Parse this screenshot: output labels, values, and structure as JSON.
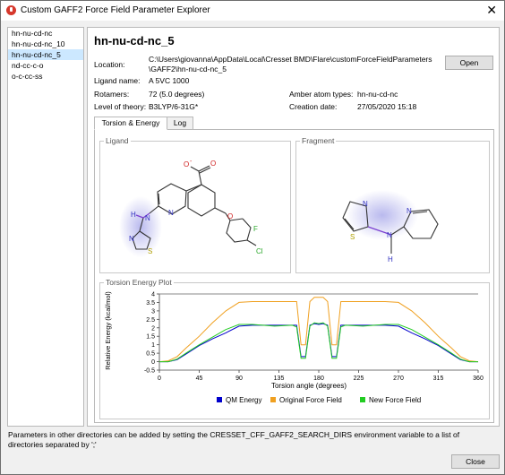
{
  "window": {
    "title": "Custom GAFF2 Force Field Parameter Explorer",
    "close_glyph": "✕"
  },
  "parameter_list": [
    "hn-nu-cd-nc",
    "hn-nu-cd-nc_10",
    "hn-nu-cd-nc_5",
    "nd-cc-c-o",
    "o-c-cc-ss"
  ],
  "selected_index": 2,
  "details": {
    "name": "hn-nu-cd-nc_5",
    "location_label": "Location:",
    "location_line1": "C:\\Users\\giovanna\\AppData\\Local\\Cresset BMD\\Flare\\customForceFieldParameters",
    "location_line2": "\\GAFF2\\hn-nu-cd-nc_5",
    "open_button": "Open",
    "ligand_name_label": "Ligand name:",
    "ligand_name": "A 5VC 1000",
    "rotamers_label": "Rotamers:",
    "rotamers": "72 (5.0 degrees)",
    "amber_label": "Amber atom types:",
    "amber_types": "hn-nu-cd-nc",
    "theory_label": "Level of theory:",
    "theory": "B3LYP/6-31G*",
    "date_label": "Creation date:",
    "date": "27/05/2020 15:18"
  },
  "tabs": [
    "Torsion & Energy",
    "Log"
  ],
  "active_tab": 0,
  "ligand_group_title": "Ligand",
  "fragment_group_title": "Fragment",
  "plot_group_title": "Torsion Energy Plot",
  "molecule_labels": {
    "ligand": {
      "o_minus": "O",
      "charge": "-",
      "o_carbonyl": "O",
      "o_ether": "O",
      "n1": "N",
      "n2": "N",
      "h": "H",
      "s": "S",
      "n3": "N",
      "f": "F",
      "cl": "Cl"
    },
    "fragment": {
      "n1": "N",
      "s": "S",
      "n2": "N",
      "n3": "N",
      "h": "H"
    }
  },
  "chart_data": {
    "type": "line",
    "xlabel": "Torsion angle (degrees)",
    "ylabel": "Relative Energy (kcal/mol)",
    "xlim": [
      0,
      360
    ],
    "ylim": [
      -0.5,
      4
    ],
    "xticks": [
      0,
      45,
      90,
      135,
      180,
      225,
      270,
      315,
      360
    ],
    "yticks": [
      -0.5,
      0,
      0.5,
      1,
      1.5,
      2,
      2.5,
      3,
      3.5,
      4
    ],
    "series": [
      {
        "name": "QM Energy",
        "color": "#0000cc",
        "x": [
          0,
          10,
          20,
          30,
          45,
          60,
          75,
          90,
          105,
          130,
          150,
          155,
          160,
          165,
          170,
          175,
          180,
          185,
          190,
          195,
          200,
          205,
          210,
          230,
          255,
          270,
          285,
          300,
          315,
          330,
          340,
          350,
          360
        ],
        "y": [
          0,
          0,
          0.12,
          0.45,
          0.95,
          1.35,
          1.7,
          2.1,
          2.15,
          2.15,
          2.15,
          2.15,
          0.3,
          0.3,
          2.15,
          2.25,
          2.2,
          2.25,
          2.15,
          0.3,
          0.3,
          2.15,
          2.15,
          2.15,
          2.15,
          2.1,
          1.7,
          1.35,
          0.95,
          0.45,
          0.12,
          0,
          0
        ]
      },
      {
        "name": "Original Force Field",
        "color": "#f0a020",
        "x": [
          0,
          10,
          20,
          30,
          45,
          60,
          75,
          90,
          105,
          130,
          150,
          155,
          160,
          165,
          170,
          175,
          180,
          185,
          190,
          195,
          200,
          205,
          210,
          230,
          255,
          270,
          285,
          300,
          315,
          330,
          340,
          350,
          360
        ],
        "y": [
          0,
          0.05,
          0.3,
          0.8,
          1.5,
          2.3,
          3.0,
          3.5,
          3.55,
          3.55,
          3.55,
          3.55,
          1.0,
          1.0,
          3.55,
          3.8,
          3.8,
          3.8,
          3.55,
          1.0,
          1.0,
          3.55,
          3.55,
          3.55,
          3.55,
          3.5,
          3.0,
          2.3,
          1.5,
          0.8,
          0.3,
          0.05,
          0
        ]
      },
      {
        "name": "New Force Field",
        "color": "#22cc22",
        "x": [
          0,
          10,
          20,
          30,
          45,
          60,
          75,
          90,
          105,
          130,
          150,
          155,
          160,
          165,
          170,
          175,
          180,
          185,
          190,
          195,
          200,
          205,
          210,
          230,
          255,
          270,
          285,
          300,
          315,
          330,
          340,
          350,
          360
        ],
        "y": [
          0,
          0,
          0.15,
          0.5,
          1.0,
          1.45,
          1.9,
          2.2,
          2.2,
          2.1,
          2.15,
          2.05,
          0.2,
          0.2,
          2.1,
          2.3,
          2.25,
          2.3,
          2.1,
          0.2,
          0.2,
          2.05,
          2.15,
          2.1,
          2.2,
          2.2,
          1.9,
          1.45,
          1.0,
          0.5,
          0.15,
          0,
          0
        ]
      }
    ],
    "reference_line": {
      "y": 4,
      "color": "#888888"
    },
    "legend_position": "bottom"
  },
  "footnote": "Parameters in other directories can be added by setting the CRESSET_CFF_GAFF2_SEARCH_DIRS environment variable to a list of directories separated by ';'",
  "close_button": "Close"
}
